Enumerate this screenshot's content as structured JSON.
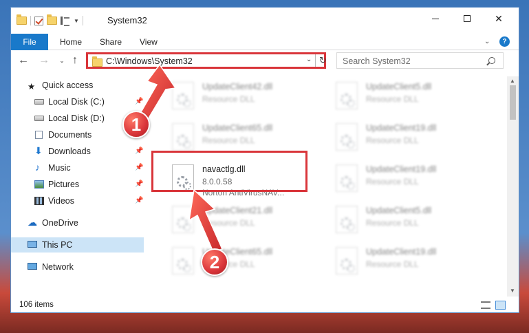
{
  "window": {
    "title": "System32"
  },
  "ribbon": {
    "file": "File",
    "home": "Home",
    "share": "Share",
    "view": "View",
    "help": "?"
  },
  "address": {
    "path": "C:\\Windows\\System32"
  },
  "search": {
    "placeholder": "Search System32"
  },
  "sidebar": {
    "items": [
      {
        "label": "Quick access",
        "icon": "star-icon",
        "pinned": false
      },
      {
        "label": "Local Disk (C:)",
        "icon": "drive-icon",
        "pinned": true
      },
      {
        "label": "Local Disk (D:)",
        "icon": "drive-icon",
        "pinned": false
      },
      {
        "label": "Documents",
        "icon": "documents-icon",
        "pinned": true
      },
      {
        "label": "Downloads",
        "icon": "downloads-icon",
        "pinned": true
      },
      {
        "label": "Music",
        "icon": "music-icon",
        "pinned": true
      },
      {
        "label": "Pictures",
        "icon": "pictures-icon",
        "pinned": true
      },
      {
        "label": "Videos",
        "icon": "videos-icon",
        "pinned": true
      },
      {
        "label": "OneDrive",
        "icon": "onedrive-icon",
        "pinned": false
      },
      {
        "label": "This PC",
        "icon": "this-pc-icon",
        "pinned": false,
        "selected": true
      },
      {
        "label": "Network",
        "icon": "network-icon",
        "pinned": false
      }
    ]
  },
  "files": [
    {
      "name": "UpdateClient42.dll",
      "desc": "Resource DLL"
    },
    {
      "name": "UpdateClient5.dll",
      "desc": "Resource DLL"
    },
    {
      "name": "UpdateClient65.dll",
      "desc": "Resource DLL"
    },
    {
      "name": "UpdateClient19.dll",
      "desc": "Resource DLL"
    },
    {
      "name": "navactlg.dll",
      "version": "8.0.0.58",
      "company": "Norton AntiVirusNAV..."
    },
    {
      "name": "UpdateClient19.dll",
      "desc": "Resource DLL"
    },
    {
      "name": "UpdateClient21.dll",
      "desc": "Resource DLL"
    },
    {
      "name": "UpdateClient5.dll",
      "desc": "Resource DLL"
    },
    {
      "name": "UpdateClient65.dll",
      "desc": "Resource DLL"
    },
    {
      "name": "UpdateClient19.dll",
      "desc": "Resource DLL"
    }
  ],
  "status": {
    "items": "106 items"
  },
  "callouts": {
    "one": "1",
    "two": "2"
  },
  "colors": {
    "accent": "#1979ca",
    "highlight": "#d9353a",
    "selected": "#cce4f7"
  }
}
